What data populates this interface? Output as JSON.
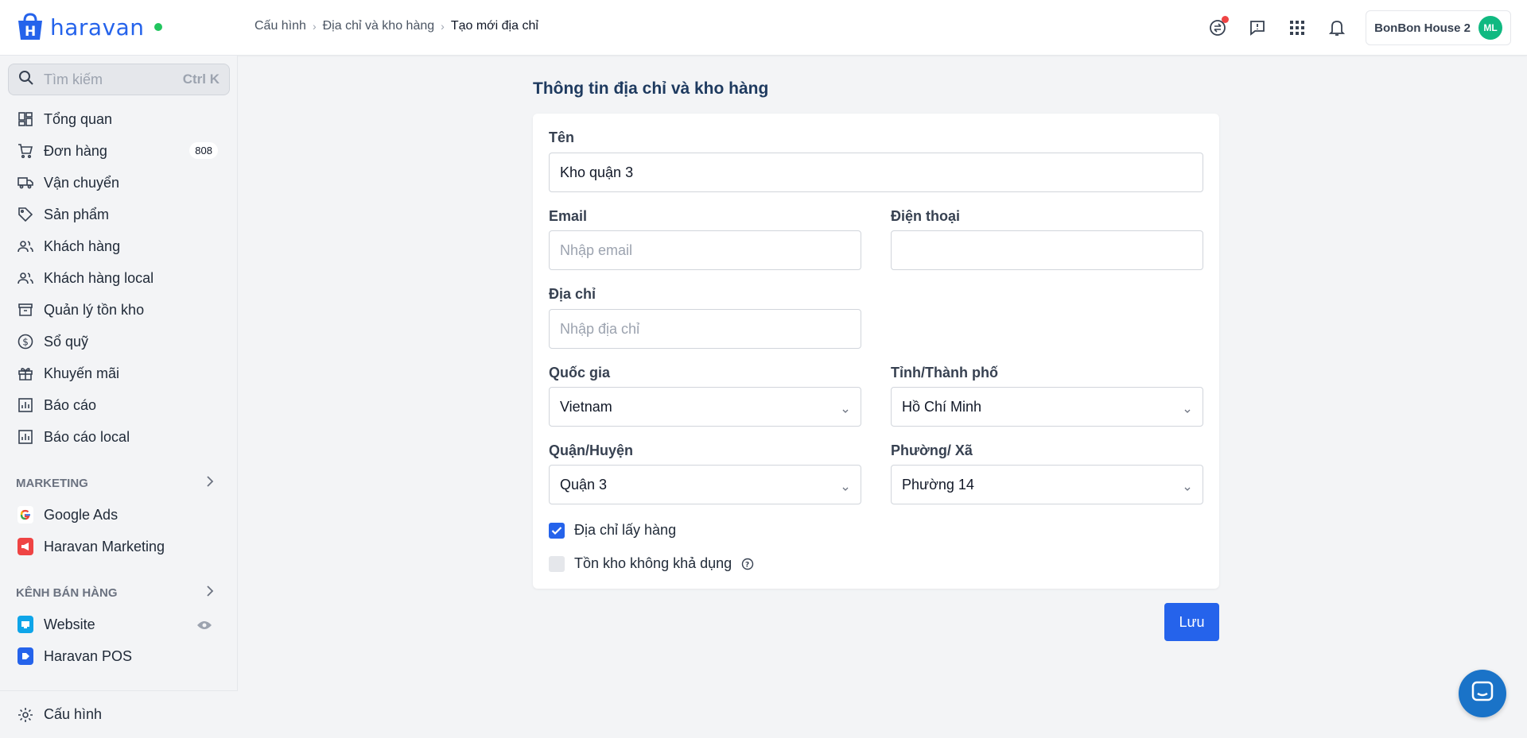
{
  "brand": {
    "name": "haravan",
    "color": "#2563eb"
  },
  "breadcrumb": {
    "items": [
      "Cấu hình",
      "Địa chỉ và kho hàng"
    ],
    "current": "Tạo mới địa chỉ"
  },
  "header": {
    "store_name": "BonBon House 2",
    "avatar_initials": "ML"
  },
  "sidebar": {
    "search": {
      "placeholder": "Tìm kiếm",
      "shortcut": "Ctrl K"
    },
    "items": [
      {
        "label": "Tổng quan",
        "icon": "dashboard-icon"
      },
      {
        "label": "Đơn hàng",
        "icon": "cart-icon",
        "badge": "808"
      },
      {
        "label": "Vận chuyển",
        "icon": "truck-icon"
      },
      {
        "label": "Sản phẩm",
        "icon": "tag-icon"
      },
      {
        "label": "Khách hàng",
        "icon": "users-icon"
      },
      {
        "label": "Khách hàng local",
        "icon": "users-icon"
      },
      {
        "label": "Quản lý tồn kho",
        "icon": "archive-icon"
      },
      {
        "label": "Sổ quỹ",
        "icon": "dollar-icon"
      },
      {
        "label": "Khuyến mãi",
        "icon": "gift-icon"
      },
      {
        "label": "Báo cáo",
        "icon": "chart-icon"
      },
      {
        "label": "Báo cáo local",
        "icon": "chart-icon"
      }
    ],
    "marketing": {
      "title": "MARKETING",
      "items": [
        {
          "label": "Google Ads",
          "icon": "google-icon"
        },
        {
          "label": "Haravan Marketing",
          "icon": "megaphone-icon"
        }
      ]
    },
    "sales_channels": {
      "title": "KÊNH BÁN HÀNG",
      "items": [
        {
          "label": "Website",
          "icon": "website-icon"
        },
        {
          "label": "Haravan POS",
          "icon": "pos-icon"
        }
      ]
    },
    "bottom": {
      "label": "Cấu hình",
      "icon": "gear-icon"
    }
  },
  "form": {
    "title": "Thông tin địa chỉ và kho hàng",
    "name": {
      "label": "Tên",
      "value": "Kho quận 3"
    },
    "email": {
      "label": "Email",
      "placeholder": "Nhập email",
      "value": ""
    },
    "phone": {
      "label": "Điện thoại",
      "value": ""
    },
    "address": {
      "label": "Địa chỉ",
      "placeholder": "Nhập địa chỉ",
      "value": ""
    },
    "country": {
      "label": "Quốc gia",
      "value": "Vietnam"
    },
    "province": {
      "label": "Tỉnh/Thành phố",
      "value": "Hồ Chí Minh"
    },
    "district": {
      "label": "Quận/Huyện",
      "value": "Quận 3"
    },
    "ward": {
      "label": "Phường/ Xã",
      "value": "Phường 14"
    },
    "pickup_address": {
      "label": "Địa chỉ lấy hàng",
      "checked": true
    },
    "unavailable_stock": {
      "label": "Tồn kho không khả dụng",
      "checked": false
    },
    "save_label": "Lưu"
  }
}
